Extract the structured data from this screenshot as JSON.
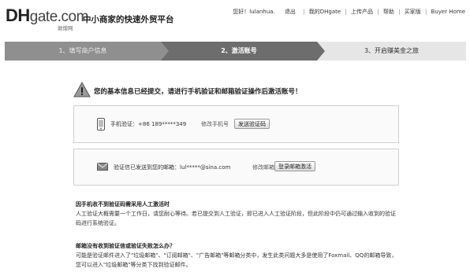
{
  "header": {
    "logo_main": "DH",
    "logo_gate": "gate.com",
    "logo_sub": "敦煌网",
    "slogan": "中小商家的快速外贸平台",
    "greeting": "您好！lulanhua.",
    "logout": "退出",
    "nav": [
      "我的DHgate",
      "上传产品",
      "帮助",
      "买家版",
      "Buyer Home"
    ]
  },
  "steps": [
    {
      "label": "1、填写商户信息"
    },
    {
      "label": "2、激活账号"
    },
    {
      "label": "3、开启赚美金之旅"
    }
  ],
  "notice": {
    "text": "您的基本信息已经提交，请进行手机验证和邮箱验证操作后激活账号！"
  },
  "phone_box": {
    "label": "手机验证：+86  189*****349",
    "modify_link": "修改手机号",
    "button": "发送验证码"
  },
  "email_box": {
    "label": "验证信已发送到您的邮箱：lul*****@sina.com",
    "modify_link": "修改邮箱",
    "button": "登录邮箱激活"
  },
  "help": [
    {
      "title": "因手机收不到验证码需采用人工激活时",
      "body": "人工验证大概需要一个工作日，请您耐心等待。若已提交到人工验证，即已进入人工验证阶段，但此阶段中仍可通过输入收到的验证码进行系统验证。"
    },
    {
      "title": "邮箱没有收到验证信或验证失败怎么办？",
      "body": "可能是验证邮件进入了\"垃圾邮箱\"、\"订阅邮箱\"、\"广告邮箱\"等邮箱分类中，发生此类问题大多是使用了Foxmail、QQ的邮箱导致，您可以进入\"垃圾邮箱\"等分类下找到验证邮件。"
    }
  ]
}
